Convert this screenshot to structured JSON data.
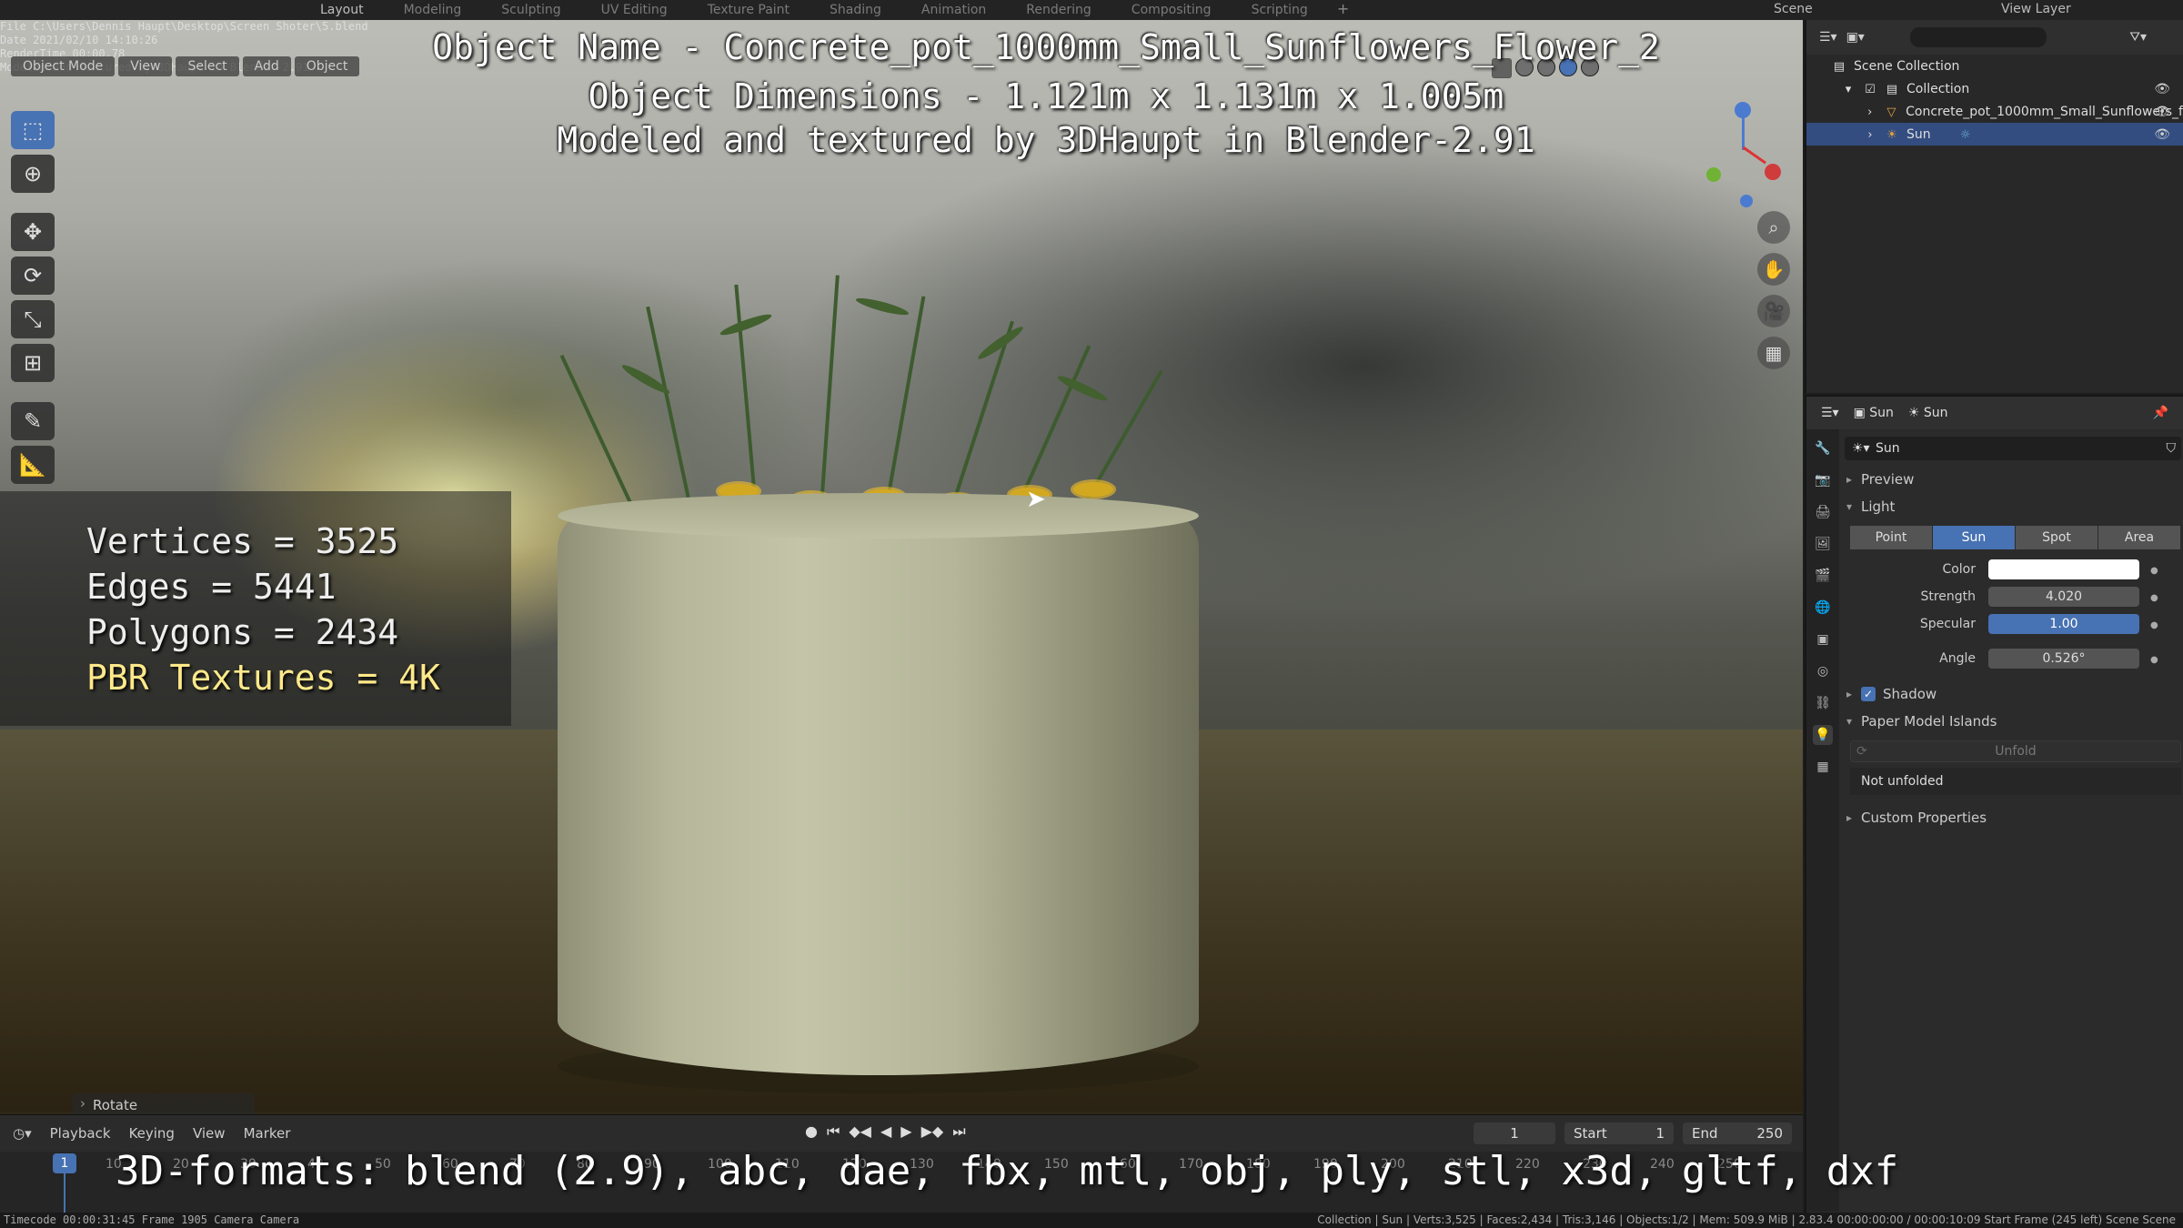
{
  "file_info": {
    "file": "File C:\\Users\\Dennis Haupt\\Desktop\\Screen Shoter\\5.blend",
    "date": "Date 2021/02/10 14:10:26",
    "rendertime": "RenderTime 00:00.78",
    "credit": "Modeled and textured by 3DHaupt in Blender-2.91"
  },
  "workspace_tabs": [
    "Layout",
    "Modeling",
    "Sculpting",
    "UV Editing",
    "Texture Paint",
    "Shading",
    "Animation",
    "Rendering",
    "Compositing",
    "Scripting"
  ],
  "workspace_add": "+",
  "scene_name": "Scene",
  "view_layer": "View Layer",
  "overlay": {
    "object_name": "Object Name - Concrete_pot_1000mm_Small_Sunflowers_Flower_2",
    "object_dimensions": "Object Dimensions - 1.121m x 1.131m x 1.005m",
    "credit": "Modeled and textured by 3DHaupt in Blender-2.91",
    "formats": "3D-formats: blend (2.9), abc, dae, fbx, mtl, obj, ply, stl, x3d, gltf, dxf"
  },
  "stats": {
    "vertices": "Vertices = 3525",
    "edges": "Edges = 5441",
    "polygons": "Polygons = 2434",
    "textures": "PBR Textures = 4K"
  },
  "viewport_header": {
    "mode": "Object Mode",
    "view": "View",
    "select": "Select",
    "add": "Add",
    "object": "Object"
  },
  "last_operator": "Rotate",
  "timeline": {
    "menus": [
      "Playback",
      "Keying",
      "View",
      "Marker"
    ],
    "current_frame": "1",
    "start_label": "Start",
    "start_value": "1",
    "end_label": "End",
    "end_value": "250",
    "ruler_ticks": [
      "10",
      "20",
      "30",
      "40",
      "50",
      "60",
      "70",
      "80",
      "90",
      "100",
      "110",
      "120",
      "130",
      "140",
      "150",
      "160",
      "170",
      "180",
      "190",
      "200",
      "210",
      "220",
      "230",
      "240",
      "250"
    ],
    "playhead": "1"
  },
  "statusbar": {
    "left": "Timecode 00:00:31:45   Frame 1905   Camera Camera",
    "right": "Collection | Sun | Verts:3,525 | Faces:2,434 | Tris:3,146 | Objects:1/2 | Mem: 509.9 MiB | 2.83.4      00:00:00:00 / 00:00:10:09      Start Frame (245 left)   Scene Scene"
  },
  "outliner": {
    "scene_collection": "Scene Collection",
    "collection": "Collection",
    "items": [
      {
        "name": "Concrete_pot_1000mm_Small_Sunflowers_f",
        "icon": "mesh-icon",
        "selected": false
      },
      {
        "name": "Sun",
        "icon": "sun-light-icon",
        "selected": true
      }
    ]
  },
  "properties": {
    "breadcrumb_object": "Sun",
    "breadcrumb_data": "Sun",
    "datablock": "Sun",
    "panels": {
      "preview": "Preview",
      "light": "Light",
      "shadow": "Shadow",
      "paper_model": "Paper Model Islands",
      "custom_props": "Custom Properties"
    },
    "light_types": [
      "Point",
      "Sun",
      "Spot",
      "Area"
    ],
    "active_light_type": "Sun",
    "color_label": "Color",
    "color_value": "#ffffff",
    "strength_label": "Strength",
    "strength_value": "4.020",
    "specular_label": "Specular",
    "specular_value": "1.00",
    "angle_label": "Angle",
    "angle_value": "0.526°",
    "unfold_label": "Unfold",
    "not_unfolded": "Not unfolded"
  },
  "colors": {
    "accent": "#4772b3",
    "selection": "#334d80",
    "panel_bg": "#2b2b2b"
  }
}
